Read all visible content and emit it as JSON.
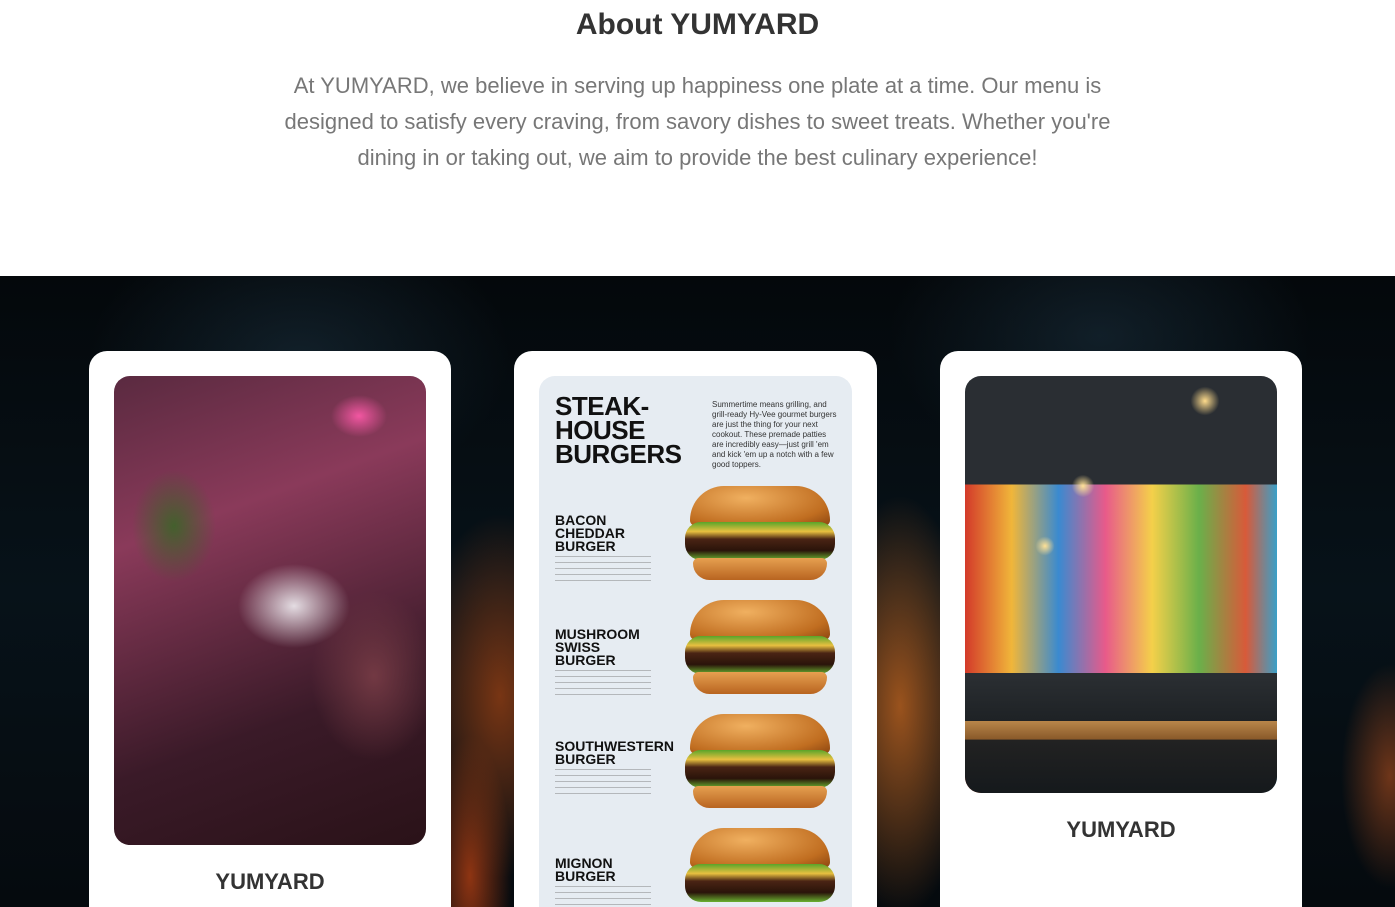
{
  "about": {
    "title": "About YUMYARD",
    "text": "At YUMYARD, we believe in serving up happiness one plate at a time. Our menu is designed to satisfy every craving, from savory dishes to sweet treats. Whether you're dining in or taking out, we aim to provide the best culinary experience!"
  },
  "gallery": {
    "cards": [
      {
        "caption": "YUMYARD"
      },
      {
        "caption": "",
        "menu": {
          "title": "STEAK-\nHOUSE\nBURGERS",
          "intro": "Summertime means grilling, and grill-ready Hy-Vee gourmet burgers are just the thing for your next cookout. These premade patties are incredibly easy—just grill 'em and kick 'em up a notch with a few good toppers.",
          "items": [
            {
              "name": "BACON\nCHEDDAR\nBURGER"
            },
            {
              "name": "MUSHROOM\nSWISS\nBURGER"
            },
            {
              "name": "SOUTHWESTERN\nBURGER"
            },
            {
              "name": "MIGNON\nBURGER"
            }
          ]
        }
      },
      {
        "caption": "YUMYARD"
      }
    ]
  }
}
